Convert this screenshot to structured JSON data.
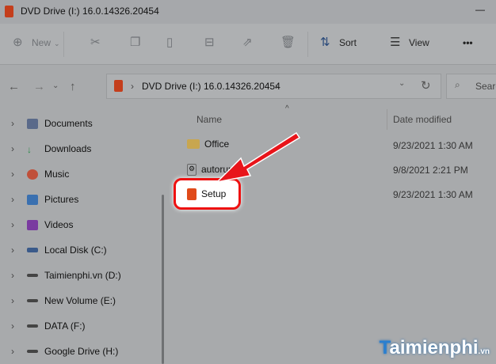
{
  "window": {
    "title": "DVD Drive (I:) 16.0.14326.20454",
    "minimize": "—"
  },
  "toolbar": {
    "new": "New",
    "sort": "Sort",
    "view": "View",
    "more": "•••"
  },
  "address": {
    "path": "DVD Drive (I:) 16.0.14326.20454",
    "search_placeholder": "Search"
  },
  "sidebar": {
    "items": [
      {
        "label": "Documents",
        "color": "#5a6a8a"
      },
      {
        "label": "Downloads",
        "color": "#2a8a4a"
      },
      {
        "label": "Music",
        "color": "#c0503a"
      },
      {
        "label": "Pictures",
        "color": "#3a70b0"
      },
      {
        "label": "Videos",
        "color": "#7a3aa0"
      },
      {
        "label": "Local Disk (C:)",
        "color": "#3a5a8a"
      },
      {
        "label": "Taimienphi.vn (D:)",
        "color": "#444"
      },
      {
        "label": "New Volume (E:)",
        "color": "#444"
      },
      {
        "label": "DATA (F:)",
        "color": "#444"
      },
      {
        "label": "Google Drive (H:)",
        "color": "#444"
      }
    ]
  },
  "columns": {
    "name": "Name",
    "date": "Date modified"
  },
  "files": [
    {
      "name": "Office",
      "date": "9/23/2021 1:30 AM",
      "type": "folder"
    },
    {
      "name": "autorun",
      "date": "9/8/2021 2:21 PM",
      "type": "settings"
    },
    {
      "name": "Setup",
      "date": "9/23/2021 1:30 AM",
      "type": "office"
    }
  ],
  "watermark": "Taimienphi.vn"
}
